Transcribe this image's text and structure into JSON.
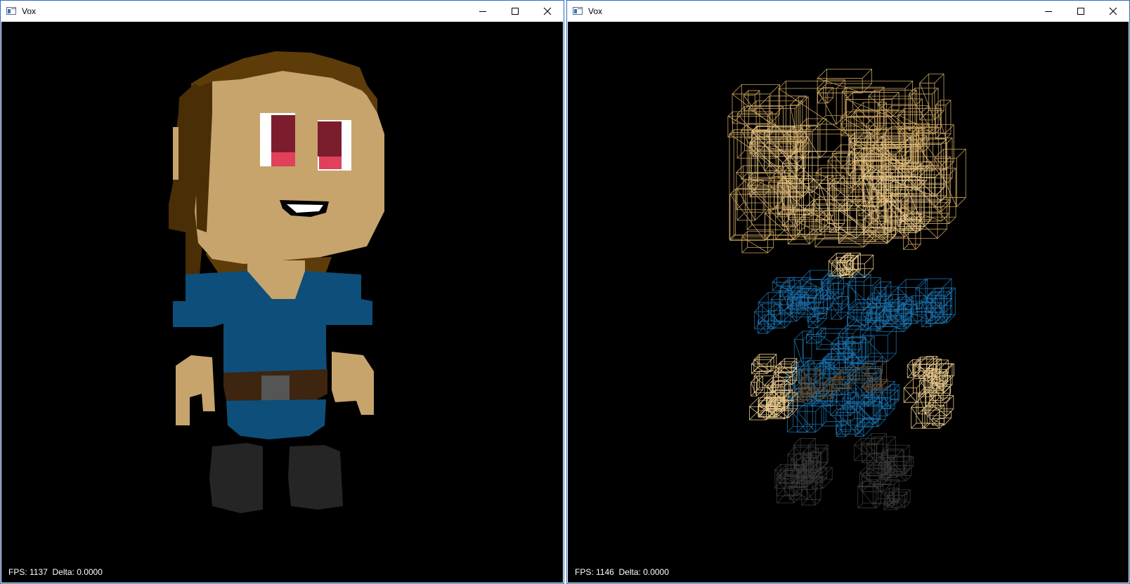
{
  "windows": [
    {
      "title": "Vox",
      "mode": "solid",
      "status": {
        "fps_label": "FPS:",
        "fps_value": "1137",
        "delta_label": "Delta:",
        "delta_value": "0.0000"
      }
    },
    {
      "title": "Vox",
      "mode": "wireframe",
      "status": {
        "fps_label": "FPS:",
        "fps_value": "1146",
        "delta_label": "Delta:",
        "delta_value": "0.0000"
      }
    }
  ],
  "colors": {
    "window_border": "#2f6cc0",
    "viewport_bg": "#000000",
    "hair": "#5e3c0a",
    "hair_dark": "#4a2e06",
    "skin": "#c6a46c",
    "shirt": "#0d4f7a",
    "belt": "#3d2510",
    "buckle": "#555555",
    "boots": "#252525",
    "eye_iris": "#7c1d2e",
    "eye_lower": "#e0405c",
    "eye_white": "#ffffff",
    "wire_hair": "#c9a25e",
    "wire_shirt": "#1a6ea8",
    "wire_skin": "#e8c88a",
    "wire_boots": "#3a3a3a",
    "wire_belt": "#6a4a2a"
  },
  "icons": {
    "app": "app-window-icon",
    "minimize": "minimize-icon",
    "maximize": "maximize-icon",
    "close": "close-icon"
  }
}
